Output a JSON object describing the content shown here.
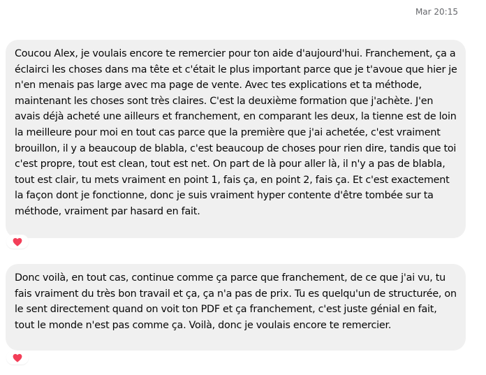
{
  "conversation": {
    "timestamp": "Mar 20:15",
    "messages": [
      {
        "text": "Coucou Alex, je voulais encore te remercier pour ton aide d'aujourd'hui. Franchement, ça a éclairci les choses dans ma tête et c'était le plus important parce que je t'avoue que hier je n'en menais pas large avec ma page de vente. Avec tes explications et ta méthode, maintenant les choses sont très claires. C'est la deuxième formation que j'achète. J'en avais déjà acheté une ailleurs et franchement, en comparant les deux, la tienne est de loin la meilleure pour moi en tout cas parce que la première que j'ai achetée, c'est vraiment brouillon, il y a beaucoup de blabla, c'est beaucoup de choses pour rien dire, tandis que toi c'est propre, tout est clean, tout est net. On part de là pour aller là, il n'y a pas de blabla, tout est clair, tu mets vraiment en point 1, fais ça, en point 2, fais ça. Et c'est exactement la façon dont je fonctionne, donc je suis vraiment hyper contente d'être tombée sur ta méthode, vraiment par hasard en fait.",
        "reaction": "heart-icon"
      },
      {
        "text": "Donc voilà, en tout cas, continue comme ça parce que franchement, de ce que j'ai vu, tu fais vraiment du très bon travail et ça, ça n'a pas de prix. Tu es quelqu'un de structurée, on le sent directement quand on voit ton PDF et ça franchement, c'est juste génial en fait, tout le monde n'est pas comme ça. Voilà, donc je voulais encore te remercier.",
        "reaction": "heart-icon"
      }
    ]
  },
  "colors": {
    "bubble_bg": "#f0f0f0",
    "text": "#050505",
    "timestamp": "#65676b",
    "heart": "#f33e58"
  }
}
